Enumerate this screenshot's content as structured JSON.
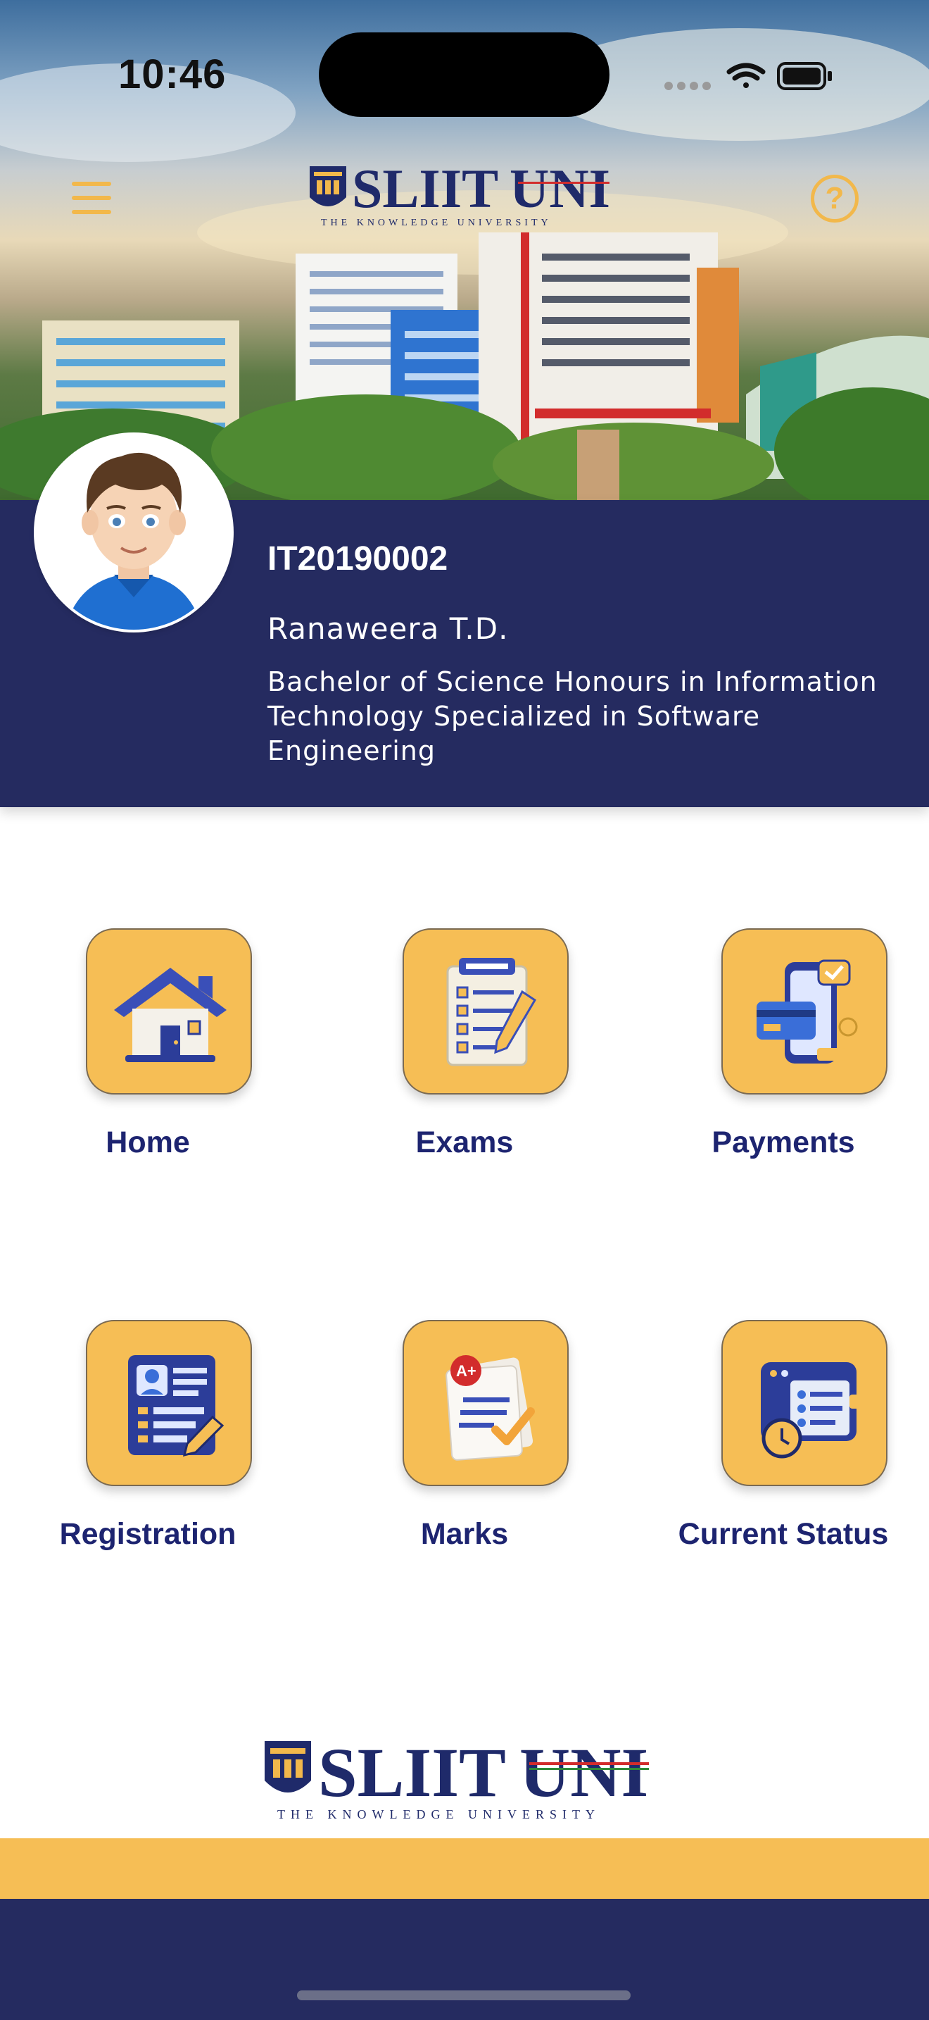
{
  "status_bar": {
    "time": "10:46"
  },
  "header": {
    "logo_main": "SLIIT",
    "logo_uni": "UNI",
    "logo_tagline": "THE KNOWLEDGE UNIVERSITY",
    "help_symbol": "?"
  },
  "profile": {
    "student_id": "IT20190002",
    "name": "Ranaweera T.D.",
    "degree": "Bachelor of Science Honours in Information Technology Specialized in Software Engineering"
  },
  "menu_tiles": [
    {
      "label": "Home",
      "icon": "house-icon"
    },
    {
      "label": "Exams",
      "icon": "exam-sheet-icon"
    },
    {
      "label": "Payments",
      "icon": "mobile-payment-icon"
    },
    {
      "label": "Registration",
      "icon": "registration-form-icon"
    },
    {
      "label": "Marks",
      "icon": "graded-paper-icon"
    },
    {
      "label": "Current Status",
      "icon": "status-checklist-icon"
    }
  ],
  "footer": {
    "logo_main": "SLIIT",
    "logo_uni": "UNI",
    "logo_tagline": "THE KNOWLEDGE UNIVERSITY"
  },
  "colors": {
    "navy": "#252b60",
    "accent_yellow": "#f6be55",
    "label_blue": "#1d2470"
  }
}
